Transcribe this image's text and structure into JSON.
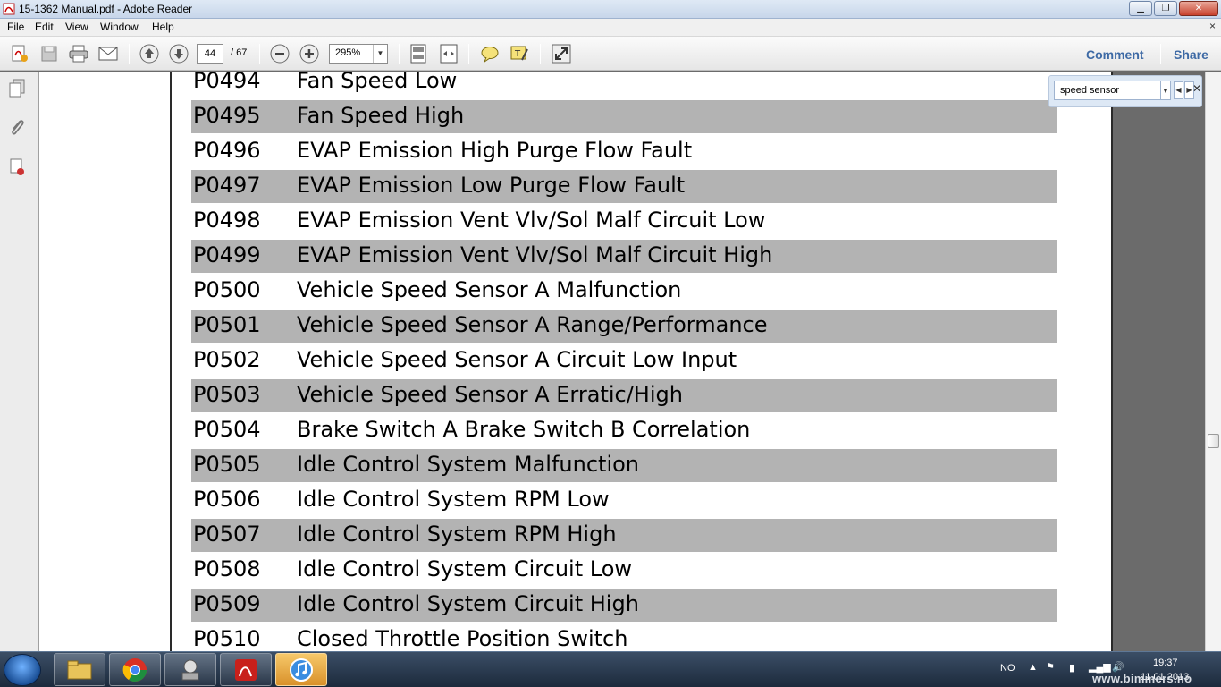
{
  "window": {
    "title": "15-1362 Manual.pdf - Adobe Reader",
    "buttons": [
      "minimize",
      "maximize",
      "close"
    ]
  },
  "menu": {
    "items": [
      "File",
      "Edit",
      "View",
      "Window",
      "Help"
    ],
    "close_glyph": "×"
  },
  "toolbar": {
    "current_page": "44",
    "page_count": "/ 67",
    "zoom": "295%",
    "comment_label": "Comment",
    "share_label": "Share"
  },
  "find": {
    "query": "speed sensor"
  },
  "document": {
    "rows": [
      {
        "code": "P0494",
        "desc": "Fan Speed Low"
      },
      {
        "code": "P0495",
        "desc": "Fan Speed High"
      },
      {
        "code": "P0496",
        "desc": "EVAP Emission High Purge Flow Fault"
      },
      {
        "code": "P0497",
        "desc": "EVAP Emission Low Purge Flow Fault"
      },
      {
        "code": "P0498",
        "desc": "EVAP Emission Vent Vlv/Sol Malf Circuit Low"
      },
      {
        "code": "P0499",
        "desc": "EVAP Emission Vent Vlv/Sol Malf Circuit High"
      },
      {
        "code": "P0500",
        "desc": "Vehicle Speed Sensor A Malfunction"
      },
      {
        "code": "P0501",
        "desc": "Vehicle Speed Sensor A Range/Performance"
      },
      {
        "code": "P0502",
        "desc": "Vehicle Speed Sensor A Circuit Low Input"
      },
      {
        "code": "P0503",
        "desc": "Vehicle Speed Sensor A Erratic/High"
      },
      {
        "code": "P0504",
        "desc": "Brake Switch A Brake Switch B Correlation"
      },
      {
        "code": "P0505",
        "desc": "Idle Control System Malfunction"
      },
      {
        "code": "P0506",
        "desc": "Idle Control System RPM Low"
      },
      {
        "code": "P0507",
        "desc": "Idle Control System RPM High"
      },
      {
        "code": "P0508",
        "desc": "Idle Control System Circuit Low"
      },
      {
        "code": "P0509",
        "desc": "Idle Control System Circuit High"
      },
      {
        "code": "P0510",
        "desc": "Closed Throttle Position Switch"
      }
    ]
  },
  "taskbar": {
    "language": "NO",
    "time": "19:37",
    "date": "11.01.2013"
  },
  "watermark": "www.bimmers.no",
  "colors": {
    "row_alt": "#b3b3b3",
    "link_blue": "#3e6aa5",
    "workspace": "#6b6b6b"
  }
}
